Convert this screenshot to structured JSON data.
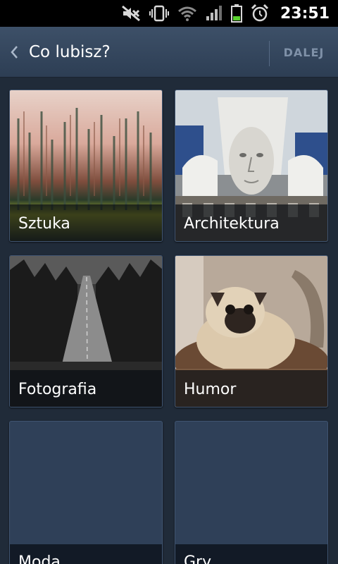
{
  "status_bar": {
    "time": "23:51",
    "icons": [
      "mute-icon",
      "vibrate-icon",
      "wifi-icon",
      "signal-icon",
      "battery-icon",
      "alarm-icon"
    ]
  },
  "action_bar": {
    "title": "Co lubisz?",
    "next_label": "DALEJ",
    "back_icon": "chevron-left-icon"
  },
  "categories": [
    {
      "label": "Sztuka",
      "image": "abstract-painting"
    },
    {
      "label": "Architektura",
      "image": "building-facade-sculpture"
    },
    {
      "label": "Fotografia",
      "image": "forest-road-bw"
    },
    {
      "label": "Humor",
      "image": "pug-dog"
    },
    {
      "label": "Moda",
      "image": ""
    },
    {
      "label": "Gry",
      "image": ""
    }
  ],
  "colors": {
    "background": "#1f2a38",
    "action_bar": "#3d5068",
    "tile_empty": "#2f4058",
    "next_disabled": "#7f91a8"
  }
}
